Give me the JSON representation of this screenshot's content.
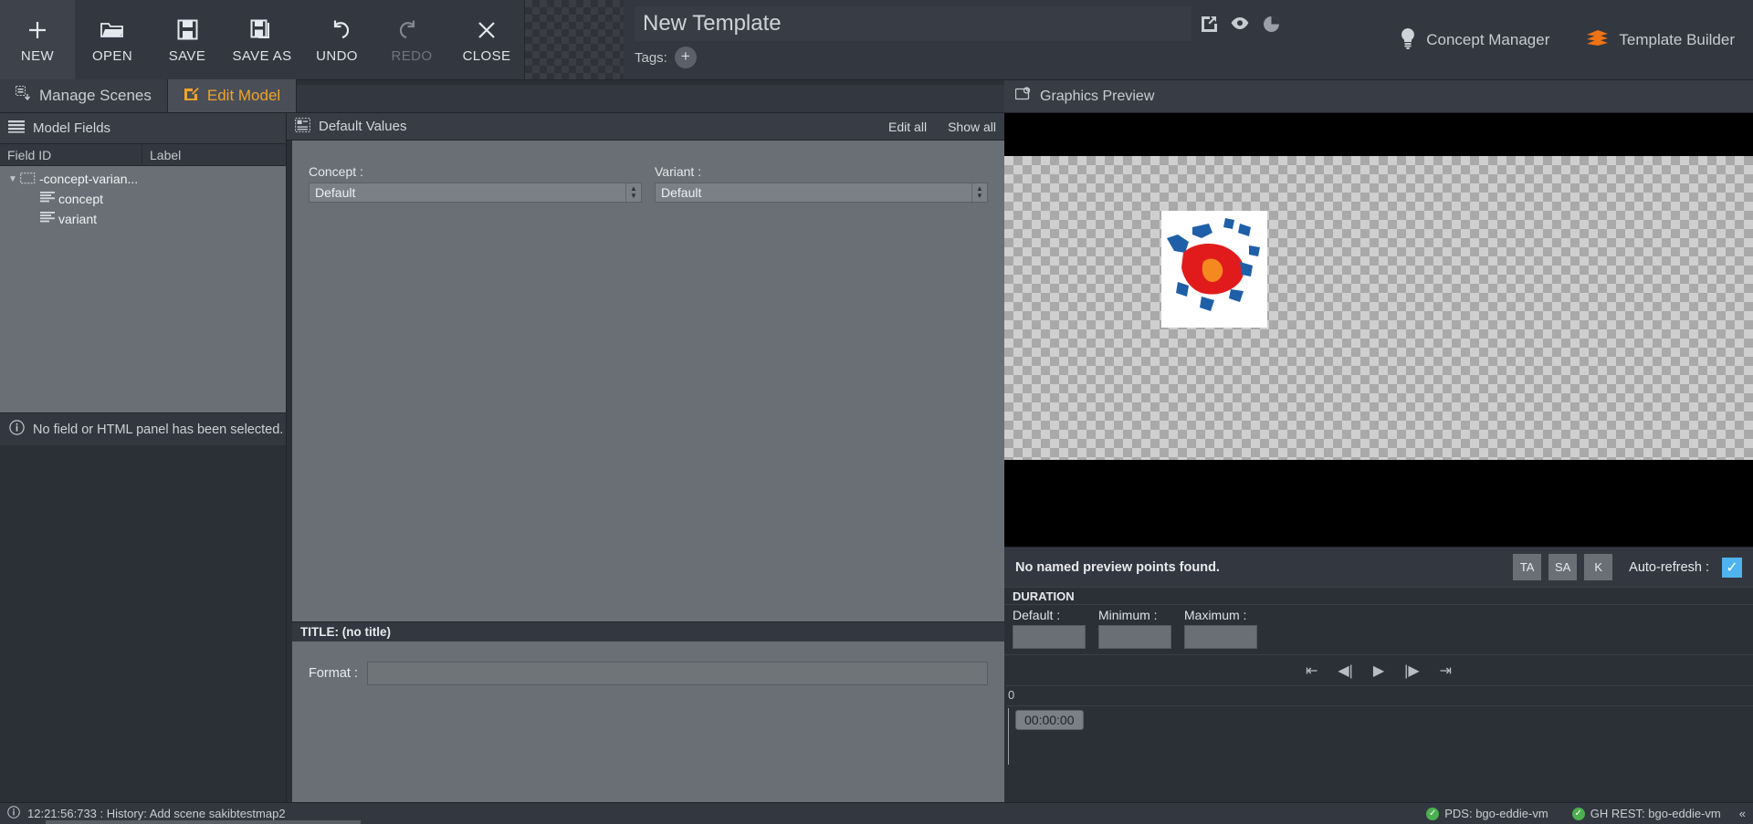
{
  "toolbar": {
    "buttons": [
      {
        "id": "new",
        "label": "NEW",
        "icon": "plus-icon",
        "disabled": false
      },
      {
        "id": "open",
        "label": "OPEN",
        "icon": "folder-icon",
        "disabled": false
      },
      {
        "id": "save",
        "label": "SAVE",
        "icon": "floppy-icon",
        "disabled": false
      },
      {
        "id": "saveas",
        "label": "SAVE AS",
        "icon": "save-as-icon",
        "disabled": false
      },
      {
        "id": "undo",
        "label": "UNDO",
        "icon": "undo-icon",
        "disabled": false
      },
      {
        "id": "redo",
        "label": "REDO",
        "icon": "redo-icon",
        "disabled": true
      },
      {
        "id": "close",
        "label": "CLOSE",
        "icon": "close-x-icon",
        "disabled": false
      }
    ],
    "template_title": "New Template",
    "tags_label": "Tags:",
    "tags_add_glyph": "+",
    "header_icons": [
      "open-external-icon",
      "eye-icon",
      "pie-clock-icon"
    ],
    "concept_manager": "Concept Manager",
    "template_builder": "Template Builder",
    "accent_color": "#f0a32a",
    "brand_orange": "#ef7215"
  },
  "tabs": [
    {
      "id": "manage-scenes",
      "label": "Manage Scenes",
      "icon": "scenes-icon",
      "active": false
    },
    {
      "id": "edit-model",
      "label": "Edit Model",
      "icon": "edit-model-icon",
      "active": true
    }
  ],
  "preview_panel_header": {
    "label": "Graphics Preview",
    "icon": "preview-icon"
  },
  "left": {
    "header": {
      "label": "Model Fields",
      "icon": "list-icon"
    },
    "columns": [
      "Field ID",
      "Label"
    ],
    "tree": [
      {
        "id": "root",
        "label": "-concept-varian...",
        "indent": 0,
        "expanded": true,
        "icon": "folder-dashed-icon",
        "value": ""
      },
      {
        "id": "concept",
        "label": "concept",
        "indent": 1,
        "expanded": null,
        "icon": "text-lines-icon",
        "value": ""
      },
      {
        "id": "variant",
        "label": "variant",
        "indent": 1,
        "expanded": null,
        "icon": "text-lines-icon",
        "value": ""
      }
    ],
    "message": "No field or HTML panel has been selected.",
    "message_icon": "info-icon"
  },
  "center": {
    "header": {
      "label": "Default Values",
      "icon": "default-values-icon"
    },
    "links": {
      "edit_all": "Edit all",
      "show_all": "Show all"
    },
    "fields": [
      {
        "id": "concept",
        "label": "Concept :",
        "value": "Default"
      },
      {
        "id": "variant",
        "label": "Variant :",
        "value": "Default"
      }
    ],
    "title_bar": "TITLE: (no title)",
    "format": {
      "label": "Format :",
      "value": "",
      "placeholder": ""
    }
  },
  "right": {
    "preview_message": "No named preview points found.",
    "keys": [
      "TA",
      "SA",
      "K"
    ],
    "auto_refresh": {
      "label": "Auto-refresh :",
      "checked": true,
      "check_glyph": "✓"
    },
    "duration": {
      "title": "DURATION",
      "fields": [
        {
          "id": "default",
          "label": "Default :",
          "value": ""
        },
        {
          "id": "minimum",
          "label": "Minimum :",
          "value": ""
        },
        {
          "id": "maximum",
          "label": "Maximum :",
          "value": ""
        }
      ]
    },
    "transport": [
      {
        "id": "go-start",
        "glyph": "⇤",
        "name": "jump-to-start"
      },
      {
        "id": "step-back",
        "glyph": "◀|",
        "name": "step-backward"
      },
      {
        "id": "play",
        "glyph": "▶",
        "name": "play"
      },
      {
        "id": "step-fwd",
        "glyph": "|▶",
        "name": "step-forward"
      },
      {
        "id": "go-end",
        "glyph": "⇥",
        "name": "jump-to-end"
      }
    ],
    "timeline": {
      "ruler_start": "0",
      "timecode": "00:00:00"
    }
  },
  "statusbar": {
    "message": "12:21:56:733 : History: Add scene sakibtestmap2",
    "icon": "info-icon",
    "services": [
      {
        "id": "pds",
        "label": "PDS: bgo-eddie-vm",
        "ok": true
      },
      {
        "id": "gh-rest",
        "label": "GH REST: bgo-eddie-vm",
        "ok": true
      }
    ],
    "collapse_glyph": "«"
  }
}
